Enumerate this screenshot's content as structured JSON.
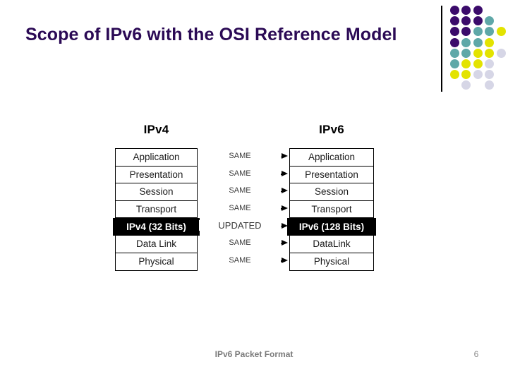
{
  "slide": {
    "title": "Scope of IPv6 with the OSI Reference Model",
    "title_color": "#2B0A55",
    "background_color": "#ffffff"
  },
  "decoration": {
    "name": "dot-grid-motif",
    "divider_color": "#000000",
    "palette": {
      "purple": "#3B0B6B",
      "teal": "#5FA8A8",
      "yellow": "#E3E300",
      "lavender": "#D6D6E6"
    },
    "dots": [
      {
        "col": 0,
        "row": 0,
        "color": "#3B0B6B"
      },
      {
        "col": 1,
        "row": 0,
        "color": "#3B0B6B"
      },
      {
        "col": 2,
        "row": 0,
        "color": "#3B0B6B"
      },
      {
        "col": 0,
        "row": 1,
        "color": "#3B0B6B"
      },
      {
        "col": 1,
        "row": 1,
        "color": "#3B0B6B"
      },
      {
        "col": 2,
        "row": 1,
        "color": "#3B0B6B"
      },
      {
        "col": 3,
        "row": 1,
        "color": "#5FA8A8"
      },
      {
        "col": 0,
        "row": 2,
        "color": "#3B0B6B"
      },
      {
        "col": 1,
        "row": 2,
        "color": "#3B0B6B"
      },
      {
        "col": 2,
        "row": 2,
        "color": "#5FA8A8"
      },
      {
        "col": 3,
        "row": 2,
        "color": "#5FA8A8"
      },
      {
        "col": 4,
        "row": 2,
        "color": "#E3E300"
      },
      {
        "col": 0,
        "row": 3,
        "color": "#3B0B6B"
      },
      {
        "col": 1,
        "row": 3,
        "color": "#5FA8A8"
      },
      {
        "col": 2,
        "row": 3,
        "color": "#5FA8A8"
      },
      {
        "col": 3,
        "row": 3,
        "color": "#E3E300"
      },
      {
        "col": 0,
        "row": 4,
        "color": "#5FA8A8"
      },
      {
        "col": 1,
        "row": 4,
        "color": "#5FA8A8"
      },
      {
        "col": 2,
        "row": 4,
        "color": "#E3E300"
      },
      {
        "col": 3,
        "row": 4,
        "color": "#E3E300"
      },
      {
        "col": 4,
        "row": 4,
        "color": "#D6D6E6"
      },
      {
        "col": 0,
        "row": 5,
        "color": "#5FA8A8"
      },
      {
        "col": 1,
        "row": 5,
        "color": "#E3E300"
      },
      {
        "col": 2,
        "row": 5,
        "color": "#E3E300"
      },
      {
        "col": 3,
        "row": 5,
        "color": "#D6D6E6"
      },
      {
        "col": 0,
        "row": 6,
        "color": "#E3E300"
      },
      {
        "col": 1,
        "row": 6,
        "color": "#E3E300"
      },
      {
        "col": 2,
        "row": 6,
        "color": "#D6D6E6"
      },
      {
        "col": 3,
        "row": 6,
        "color": "#D6D6E6"
      },
      {
        "col": 1,
        "row": 7,
        "color": "#D6D6E6"
      },
      {
        "col": 3,
        "row": 7,
        "color": "#D6D6E6"
      }
    ]
  },
  "diagram": {
    "left_heading": "IPv4",
    "right_heading": "IPv6",
    "highlight_color": "#000000",
    "left_layers": [
      {
        "label": "Application",
        "highlight": false
      },
      {
        "label": "Presentation",
        "highlight": false
      },
      {
        "label": "Session",
        "highlight": false
      },
      {
        "label": "Transport",
        "highlight": false
      },
      {
        "label": "IPv4 (32 Bits)",
        "highlight": true
      },
      {
        "label": "Data Link",
        "highlight": false
      },
      {
        "label": "Physical",
        "highlight": false
      }
    ],
    "right_layers": [
      {
        "label": "Application",
        "highlight": false
      },
      {
        "label": "Presentation",
        "highlight": false
      },
      {
        "label": "Session",
        "highlight": false
      },
      {
        "label": "Transport",
        "highlight": false
      },
      {
        "label": "IPv6 (128 Bits)",
        "highlight": true
      },
      {
        "label": "DataLink",
        "highlight": false
      },
      {
        "label": "Physical",
        "highlight": false
      }
    ],
    "connectors": [
      {
        "label": "SAME",
        "emphasis": false
      },
      {
        "label": "SAME",
        "emphasis": false
      },
      {
        "label": "SAME",
        "emphasis": false
      },
      {
        "label": "SAME",
        "emphasis": false
      },
      {
        "label": "UPDATED",
        "emphasis": true
      },
      {
        "label": "SAME",
        "emphasis": false
      },
      {
        "label": "SAME",
        "emphasis": false
      }
    ]
  },
  "footer": {
    "title": "IPv6 Packet Format",
    "page_number": "6"
  }
}
